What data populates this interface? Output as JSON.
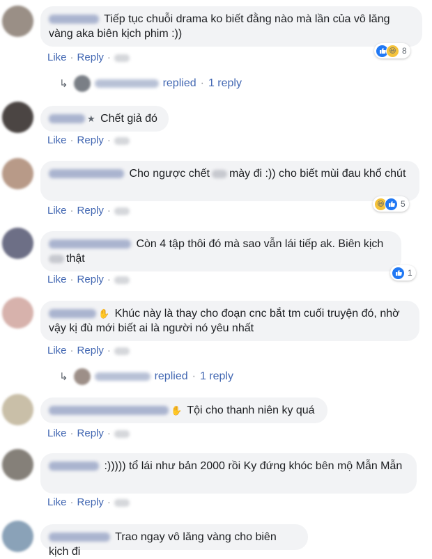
{
  "actions": {
    "like": "Like",
    "reply": "Reply",
    "sep": "·"
  },
  "reply_bar": {
    "replied": "replied",
    "sep": "·",
    "count": "1 reply"
  },
  "comments": [
    {
      "text": "Tiếp tục chuỗi drama ko biết đằng nào mà lần của vô lăng vàng aka biên kịch phim :))",
      "reaction_count": "8",
      "reactions": [
        "like",
        "haha"
      ]
    },
    {
      "badge": "★",
      "text": "Chết giả đó"
    },
    {
      "text_a": "Cho ngược chết",
      "text_b": "mày đi :)) cho biết mùi đau khổ chút",
      "reaction_count": "5",
      "reactions": [
        "haha",
        "like"
      ]
    },
    {
      "text": "Còn 4 tập thôi đó mà sao vẫn lái tiếp ak. Biên kịch",
      "text_b": "thật",
      "reaction_count": "1",
      "reactions": [
        "like"
      ]
    },
    {
      "badge": "✋",
      "text": "Khúc này là thay cho đoạn cnc bắt tm cuối truyện đó, nhờ vậy kị đù mới biết ai là người nó yêu nhất"
    },
    {
      "badge": "✋",
      "text": "Tội cho thanh niên ky quá"
    },
    {
      "text": ":))))) tổ lái như bản 2000 rồi Ky đứng khóc bên mộ Mẫn Mẫn"
    },
    {
      "text": "Trao ngay vô lăng vàng cho biên kịch đi"
    }
  ]
}
